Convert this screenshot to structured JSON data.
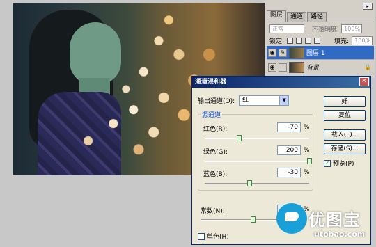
{
  "layers_panel": {
    "tabs": [
      {
        "label": "图层",
        "active": true
      },
      {
        "label": "通道",
        "active": false
      },
      {
        "label": "路径",
        "active": false
      }
    ],
    "blend_mode": "正常",
    "opacity_label": "不透明度:",
    "opacity_value": "100%",
    "lock_label": "锁定:",
    "fill_label": "填充:",
    "fill_value": "100%",
    "layers": [
      {
        "name": "图层 1",
        "selected": true
      },
      {
        "name": "背景",
        "selected": false,
        "locked": true
      }
    ]
  },
  "dialog": {
    "title": "通道混和器",
    "output_channel_label": "输出通道(O):",
    "output_channel_value": "红",
    "source_group_title": "源通道",
    "channels": [
      {
        "label": "红色(R):",
        "value": "-70",
        "slider_percent": -70
      },
      {
        "label": "绿色(G):",
        "value": "200",
        "slider_percent": 200
      },
      {
        "label": "蓝色(B):",
        "value": "-30",
        "slider_percent": -30
      }
    ],
    "constant_label": "常数(N):",
    "constant_value": "0",
    "constant_slider_percent": 0,
    "percent_sign": "%",
    "monochrome_label": "单色(H)",
    "monochrome_checked": false,
    "buttons": {
      "ok": "好",
      "reset": "复位",
      "load": "载入(L)...",
      "save": "存储(S)..."
    },
    "preview_label": "预览(P)",
    "preview_checked": true
  },
  "watermark": {
    "site_name": "优图宝",
    "url": "utobao.com"
  },
  "colors": {
    "titlebar": "#0a246a",
    "selected_layer": "#316ac5",
    "group_title": "#0046d5"
  }
}
